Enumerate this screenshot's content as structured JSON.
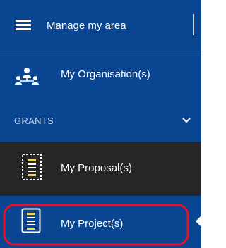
{
  "header": {
    "title": "Manage my area",
    "menu_icon": "hamburger-menu-icon"
  },
  "menu": {
    "organisation": {
      "label": "My Organisation(s)",
      "icon": "organisation-network-icon"
    },
    "grants_section": {
      "label": "GRANTS",
      "icon": "chevron-down-icon"
    },
    "proposal": {
      "label": "My Proposal(s)",
      "icon": "proposal-document-icon",
      "state": "hover"
    },
    "project": {
      "label": "My Project(s)",
      "icon": "project-document-icon",
      "state": "selected"
    }
  },
  "annotation": {
    "highlight_color": "#e8102a"
  },
  "colors": {
    "sidebar_bg": "#0a4592",
    "hover_bg": "#262626",
    "text": "#ffffff",
    "section_text": "#c5d2e8"
  }
}
